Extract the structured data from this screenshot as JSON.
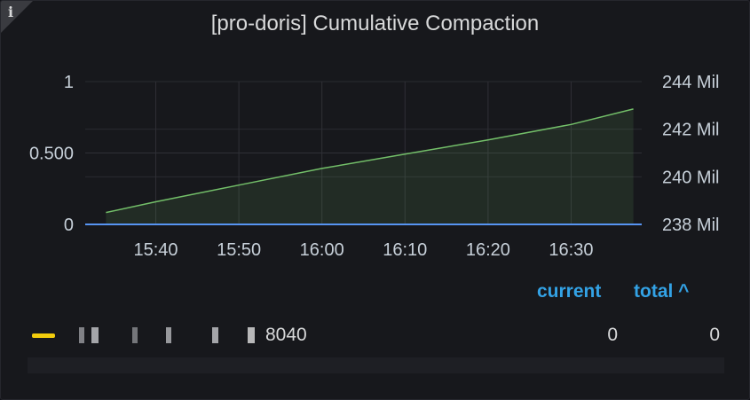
{
  "panel": {
    "title": "[pro-doris] Cumulative Compaction",
    "info_icon": "info-icon"
  },
  "chart_data": {
    "type": "area",
    "x": [
      "15:40",
      "15:50",
      "16:00",
      "16:10",
      "16:20",
      "16:30"
    ],
    "left_axis": {
      "ticks": [
        "1",
        "0.500",
        "0"
      ],
      "ylim": [
        0,
        1
      ]
    },
    "right_axis": {
      "ticks": [
        "244 Mil",
        "242 Mil",
        "240 Mil",
        "238 Mil"
      ],
      "ylim": [
        238,
        244
      ],
      "unit": "Mil"
    },
    "grid": true,
    "series": [
      {
        "axis": "left",
        "color": "#f2cc0c",
        "values": [
          0,
          0,
          0,
          0,
          0,
          0,
          0
        ]
      },
      {
        "axis": "left",
        "color": "#5794f2",
        "values": [
          0,
          0,
          0,
          0,
          0,
          0,
          0
        ]
      },
      {
        "axis": "right",
        "color": "#73bf69",
        "x_minutes": [
          -6,
          0,
          10,
          20,
          30,
          40,
          50,
          57.5
        ],
        "values": [
          238.5,
          238.95,
          239.65,
          240.35,
          240.95,
          241.55,
          242.2,
          242.85
        ]
      }
    ]
  },
  "legend": {
    "columns": {
      "current": "current",
      "total": "total ^"
    },
    "rows": [
      {
        "name": "8040",
        "color": "#f2cc0c",
        "current": "0",
        "total": "0"
      },
      {
        "name": "",
        "color": "",
        "current": "",
        "total": ""
      }
    ]
  }
}
